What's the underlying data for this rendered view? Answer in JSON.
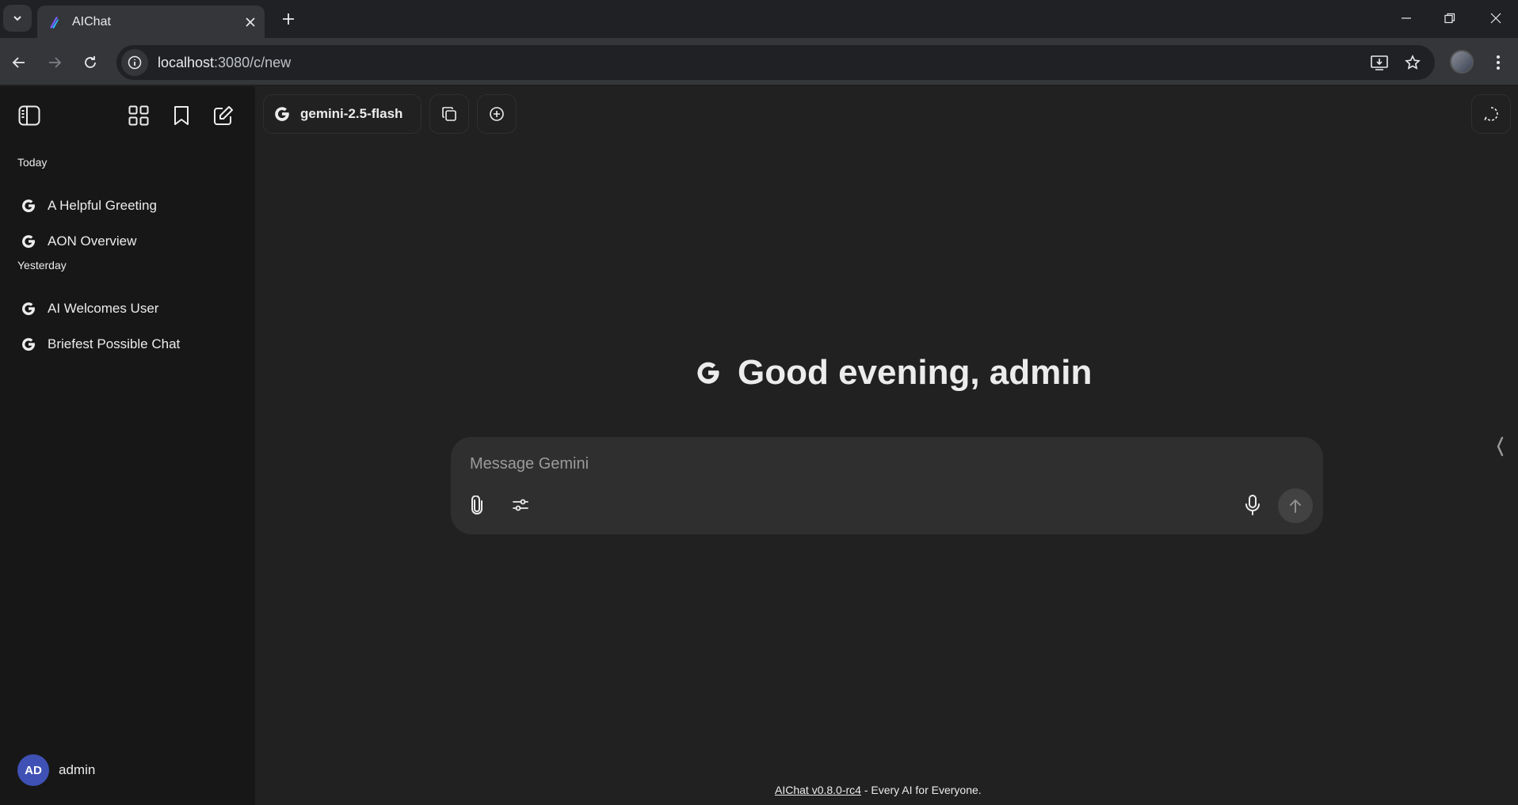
{
  "browser": {
    "tab_title": "AIChat",
    "url_host": "localhost",
    "url_path": ":3080/c/new"
  },
  "sidebar": {
    "groups": [
      {
        "label": "Today",
        "items": [
          {
            "label": "A Helpful Greeting"
          },
          {
            "label": "AON Overview"
          }
        ]
      },
      {
        "label": "Yesterday",
        "items": [
          {
            "label": "AI Welcomes User"
          },
          {
            "label": "Briefest Possible Chat"
          }
        ]
      }
    ],
    "user": {
      "initials": "AD",
      "name": "admin"
    }
  },
  "header": {
    "model_label": "gemini-2.5-flash"
  },
  "main": {
    "greeting": "Good evening, admin",
    "composer_placeholder": "Message Gemini"
  },
  "footer": {
    "link_text": "AIChat v0.8.0-rc4",
    "tagline": " - Every AI for Everyone."
  },
  "colors": {
    "background": "#212121",
    "sidebar": "#171717",
    "composer": "#2f2f2f",
    "avatar": "#3f51b5"
  }
}
